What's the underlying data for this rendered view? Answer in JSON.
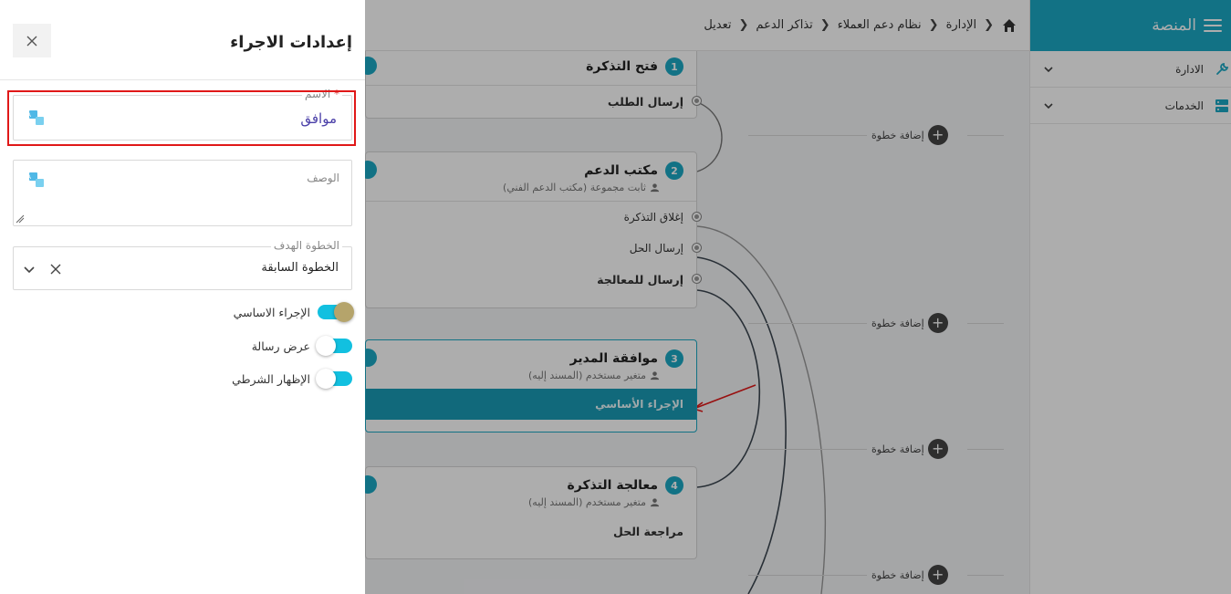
{
  "sidebar": {
    "brand": "المنصة",
    "items": [
      {
        "label": "الادارة"
      },
      {
        "label": "الخدمات"
      }
    ]
  },
  "breadcrumb": {
    "items": [
      "الإدارة",
      "نظام دعم العملاء",
      "تذاكر الدعم",
      "تعديل"
    ]
  },
  "canvas": {
    "add_step_label": "إضافة خطوة",
    "steps": [
      {
        "num": "1",
        "title": "فتح التذكرة",
        "subtitle": "",
        "actions": [
          "إرسال الطلب"
        ]
      },
      {
        "num": "2",
        "title": "مكتب الدعم",
        "subtitle": "ثابت مجموعة (مكتب الدعم الفني)",
        "actions": [
          "إغلاق التذكرة",
          "إرسال الحل",
          "إرسال للمعالجة"
        ]
      },
      {
        "num": "3",
        "title": "موافقة المدير",
        "subtitle": "متغير مستخدم (المسند إليه)",
        "actions": [
          "الإجراء الأساسي"
        ]
      },
      {
        "num": "4",
        "title": "معالجة التذكرة",
        "subtitle": "متغير مستخدم (المسند إليه)",
        "actions": [
          "مراجعة الحل"
        ]
      }
    ]
  },
  "panel": {
    "title": "إعدادات الاجراء",
    "name_field": {
      "label": "الاسم",
      "required_mark": "*",
      "value": "موافق"
    },
    "description_field": {
      "label": "الوصف",
      "value": ""
    },
    "target_step_field": {
      "label": "الخطوة الهدف",
      "value": "الخطوة السابقة"
    },
    "toggles": [
      {
        "label": "الإجراء الاساسي",
        "on": true
      },
      {
        "label": "عرض رسالة",
        "on": false
      },
      {
        "label": "الإظهار الشرطي",
        "on": false
      }
    ]
  },
  "colors": {
    "accent": "#1ba9c4",
    "highlight": "#e01818",
    "value_text": "#4a3fa8"
  }
}
